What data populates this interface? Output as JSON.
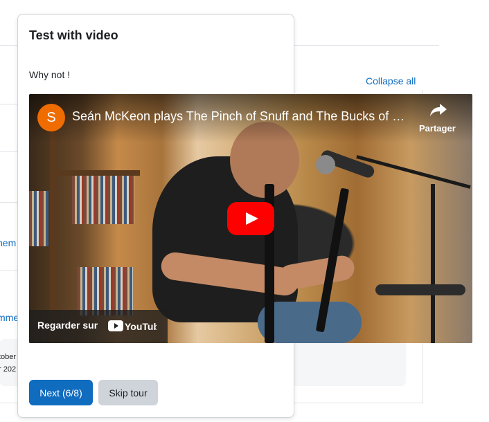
{
  "background": {
    "collapse_label": "Collapse all",
    "fragments": {
      "link_a": "nem",
      "link_b": "mme",
      "date_a": "tober",
      "date_b": "r 202"
    }
  },
  "tour": {
    "title": "Test with video",
    "body": "Why not !",
    "next_label": "Next (6/8)",
    "skip_label": "Skip tour"
  },
  "video": {
    "channel_initial": "S",
    "channel_color": "#ef6c00",
    "title": "Seán McKeon plays The Pinch of Snuff and The Bucks of Oranmore",
    "share_label": "Partager",
    "watch_on_label": "Regarder sur",
    "platform": "YouTube",
    "play_color": "#ff0000"
  },
  "colors": {
    "primary": "#0f6cbf",
    "secondary": "#ced4da"
  }
}
